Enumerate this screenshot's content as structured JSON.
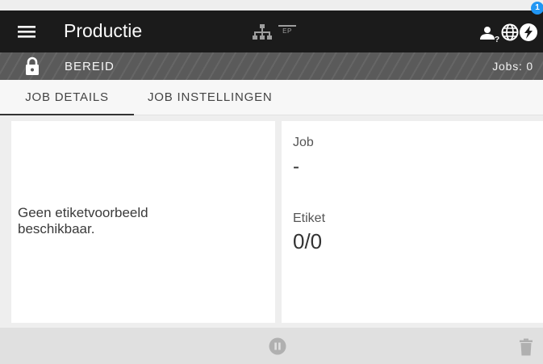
{
  "header": {
    "title": "Productie",
    "ep_label": "EP",
    "notification_count": "1"
  },
  "status": {
    "state": "BEREID",
    "jobs": "Jobs: 0"
  },
  "tabs": [
    {
      "label": "JOB DETAILS",
      "active": true
    },
    {
      "label": "JOB INSTELLINGEN",
      "active": false
    }
  ],
  "preview": {
    "message": "Geen etiketvoorbeeld beschikbaar."
  },
  "details": {
    "job_label": "Job",
    "job_value": "-",
    "label_label": "Etiket",
    "label_value": "0/0"
  },
  "colors": {
    "topbar": "#1b1b1b",
    "statusbar": "#5a5a5a",
    "badge": "#2196f3"
  },
  "icons": [
    "menu-icon",
    "network-icon",
    "ep-icon",
    "user-help-icon",
    "globe-icon",
    "alert-icon",
    "lock-icon",
    "pause-icon",
    "trash-icon"
  ]
}
